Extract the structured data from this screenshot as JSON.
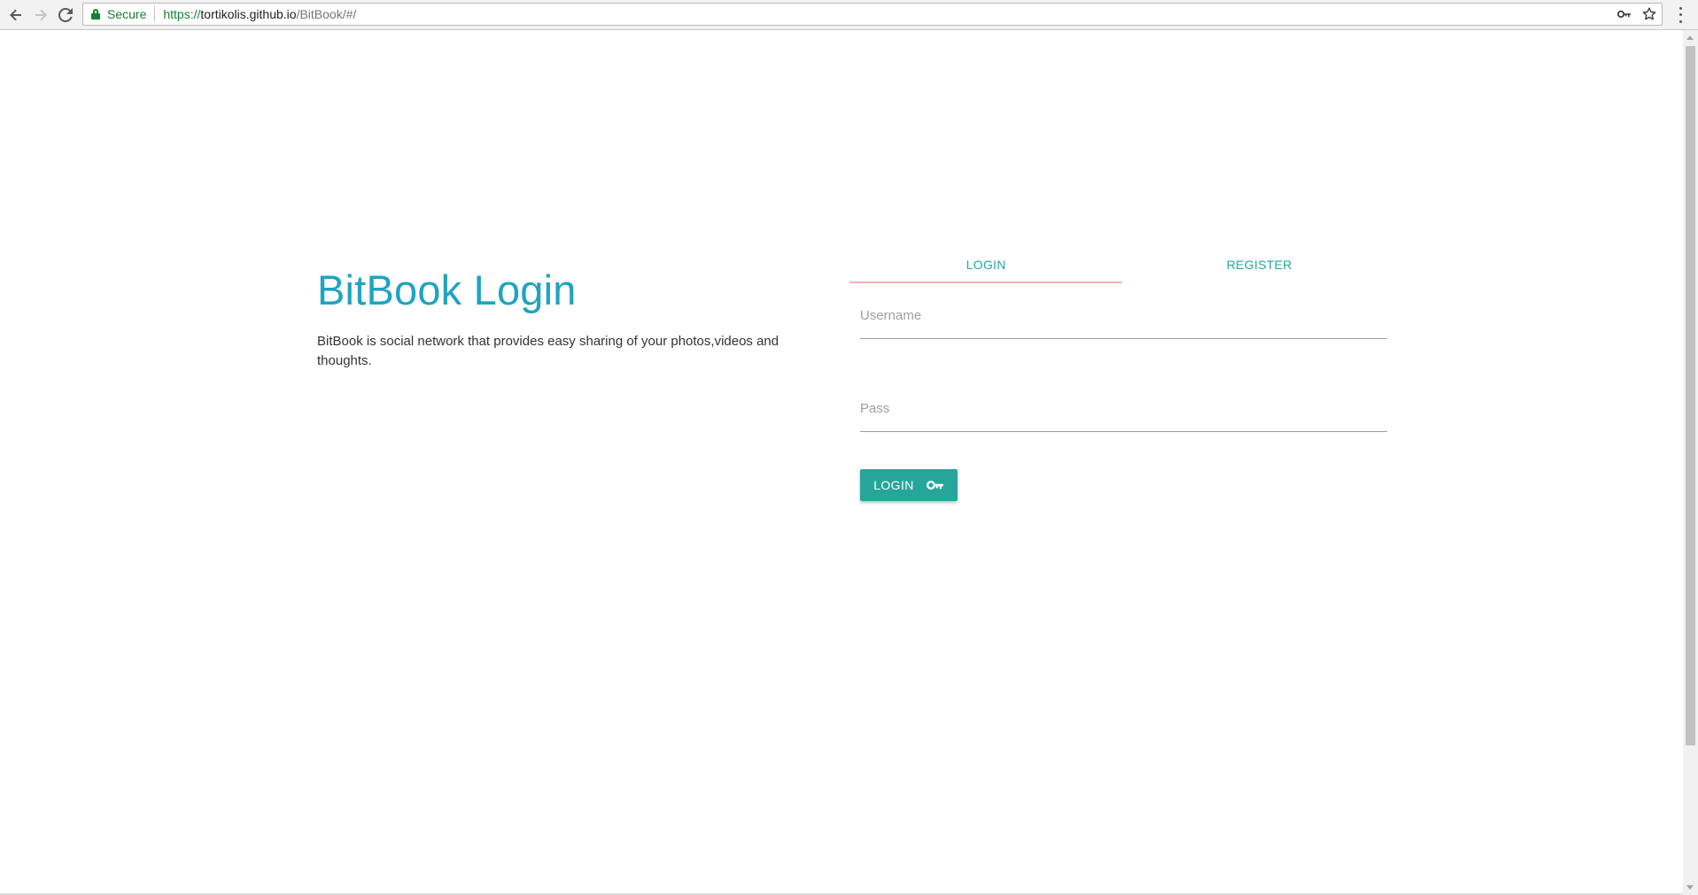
{
  "browser": {
    "secure_label": "Secure",
    "url_scheme": "https://",
    "url_host": "tortikolis.github.io",
    "url_path": "/BitBook/#/"
  },
  "intro": {
    "title": "BitBook Login",
    "description": "BitBook is social network that provides easy sharing of your photos,videos and thoughts."
  },
  "auth": {
    "tabs": [
      {
        "label": "LOGIN",
        "active": true
      },
      {
        "label": "REGISTER",
        "active": false
      }
    ],
    "username_placeholder": "Username",
    "password_placeholder": "Pass",
    "login_button_label": "LOGIN",
    "login_button_icon": "key-icon"
  },
  "colors": {
    "accent": "#26a69a",
    "title": "#1fa3c2",
    "tab_indicator": "#f6b2b5"
  }
}
